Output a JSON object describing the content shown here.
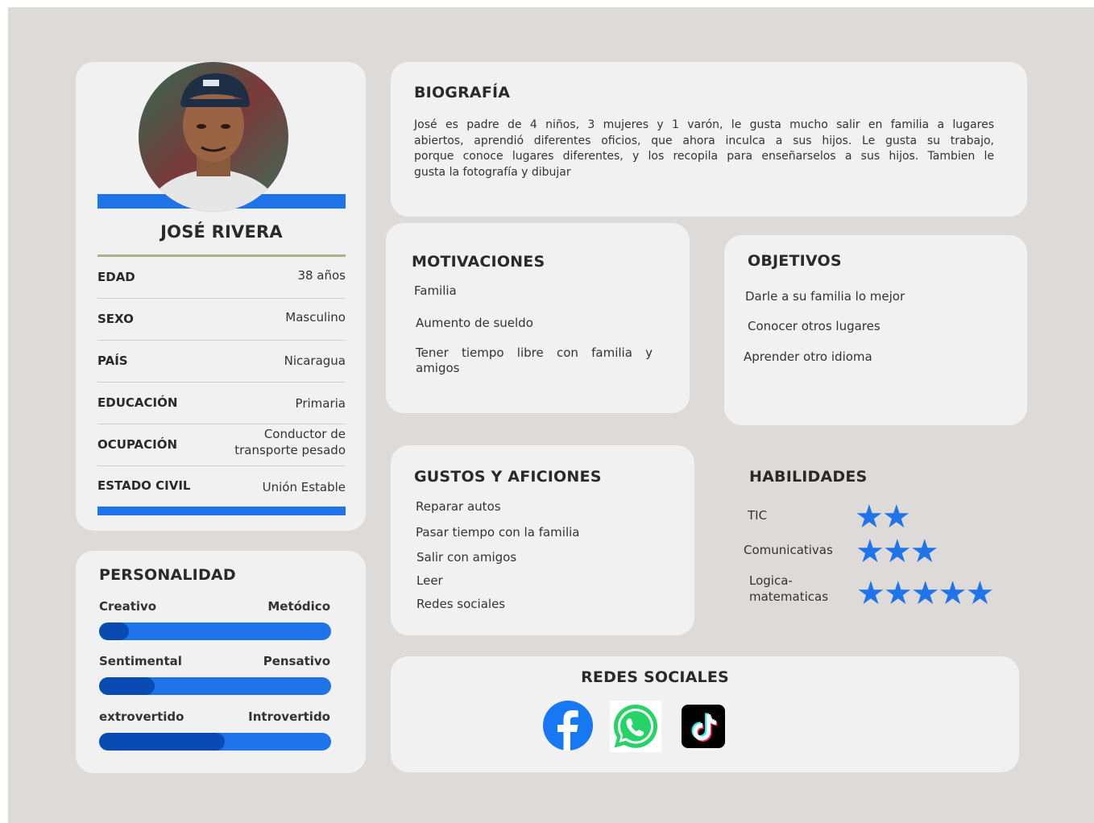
{
  "profile": {
    "name": "JOSÉ RIVERA",
    "fields": [
      {
        "label": "EDAD",
        "value": "38 años"
      },
      {
        "label": "SEXO",
        "value": "Masculino"
      },
      {
        "label": "PAÍS",
        "value": "Nicaragua"
      },
      {
        "label": "EDUCACIÓN",
        "value": "Primaria"
      },
      {
        "label": "OCUPACIÓN",
        "value_line1": "Conductor de",
        "value_line2": "transporte pesado"
      },
      {
        "label": "ESTADO CIVIL",
        "value": "Unión Estable"
      }
    ]
  },
  "personality": {
    "title": "PERSONALIDAD",
    "traits": [
      {
        "left": "Creativo",
        "right": "Metódico",
        "level": 0.13
      },
      {
        "left": "Sentimental",
        "right": "Pensativo",
        "level": 0.24
      },
      {
        "left": "extrovertido",
        "right": "Introvertido",
        "level": 0.54
      }
    ]
  },
  "biography": {
    "title": "BIOGRAFÍA",
    "lines": [
      "José es padre de 4 niños, 3 mujeres y 1 varón,  le gusta mucho salir en familia a lugares",
      "abiertos, aprendió diferentes oficios, que ahora inculca a sus hijos.  Le gusta su trabajo,",
      "porque conoce lugares diferentes, y los recopila para enseñarselos a sus hijos. Tambien le",
      "gusta la fotografía y dibujar"
    ]
  },
  "motivations": {
    "title": "MOTIVACIONES",
    "items": [
      "Familia",
      "Aumento de sueldo",
      "Tener tiempo libre con familia y",
      "amigos"
    ]
  },
  "objectives": {
    "title": "OBJETIVOS",
    "items": [
      "Darle a su familia lo mejor",
      "Conocer otros lugares",
      "Aprender otro idioma"
    ]
  },
  "hobbies": {
    "title": "GUSTOS Y AFICIONES",
    "items": [
      "Reparar autos",
      "Pasar tiempo con la familia",
      "Salir con amigos",
      "Leer",
      "Redes sociales"
    ]
  },
  "skills": {
    "title": "HABILIDADES",
    "items": [
      {
        "label": "TIC",
        "stars": 2
      },
      {
        "label": "Comunicativas",
        "stars": 3
      },
      {
        "label_line1": "Logica-",
        "label_line2": "matematicas",
        "stars": 5
      }
    ]
  },
  "social": {
    "title": "REDES SOCIALES",
    "icons": [
      "facebook-icon",
      "whatsapp-icon",
      "tiktok-icon"
    ]
  },
  "colors": {
    "accent": "#1f74ea",
    "accent_dark": "#0a4bb3",
    "background": "#dedad8",
    "card": "#f2f1f1"
  }
}
